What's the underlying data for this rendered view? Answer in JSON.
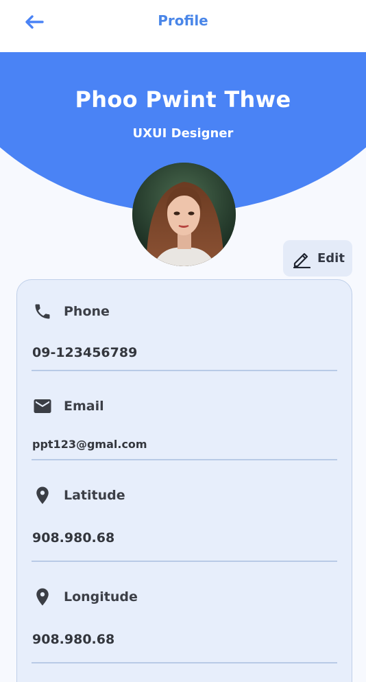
{
  "header": {
    "title": "Profile"
  },
  "profile": {
    "name": "Phoo Pwint Thwe",
    "role": "UXUI Designer"
  },
  "edit_button": {
    "label": "Edit"
  },
  "fields": [
    {
      "label": "Phone",
      "value": "09-123456789",
      "icon": "phone-icon"
    },
    {
      "label": "Email",
      "value": "ppt123@gmal.com",
      "icon": "email-icon"
    },
    {
      "label": "Latitude",
      "value": "908.980.68",
      "icon": "location-pin-icon"
    },
    {
      "label": "Longitude",
      "value": "908.980.68",
      "icon": "location-pin-icon"
    }
  ],
  "colors": {
    "accent": "#4a83f5",
    "title": "#4a86e8",
    "background": "#f7f9fe",
    "card": "#e7eefb",
    "card_border": "#bfcfe9"
  }
}
